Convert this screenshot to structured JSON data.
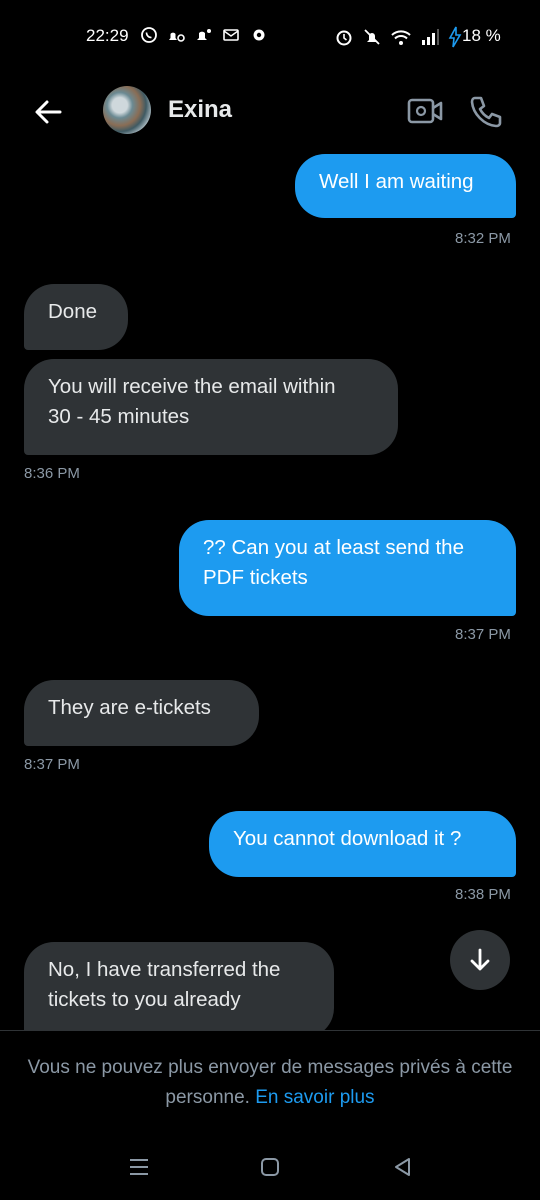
{
  "status_bar": {
    "time": "22:29",
    "battery": "18 %",
    "left_icons": [
      "whatsapp-icon",
      "notification-icon",
      "notification-icon",
      "mail-icon",
      "settings-icon"
    ],
    "right_icons": [
      "alarm-icon",
      "mute-icon",
      "wifi-icon",
      "signal-icon",
      "charging-icon"
    ]
  },
  "header": {
    "contact_name": "Exina",
    "icons": [
      "back-arrow-icon",
      "video-call-icon",
      "phone-icon"
    ]
  },
  "messages": [
    {
      "side": "sent",
      "text": "Well I am waiting"
    },
    {
      "side": "sent",
      "time": "8:32 PM"
    },
    {
      "side": "received",
      "text": "Done"
    },
    {
      "side": "received",
      "text": "You will receive the email within\n30 - 45 minutes"
    },
    {
      "side": "received",
      "time": "8:36 PM"
    },
    {
      "side": "sent",
      "text": "?? Can you at least send the\nPDF tickets"
    },
    {
      "side": "sent",
      "time": "8:37 PM"
    },
    {
      "side": "received",
      "text": "They are e-tickets"
    },
    {
      "side": "received",
      "time": "8:37 PM"
    },
    {
      "side": "sent",
      "text": "You cannot download it ?"
    },
    {
      "side": "sent",
      "time": "8:38 PM"
    },
    {
      "side": "received",
      "text": "No, I have transferred the\ntickets to you already"
    }
  ],
  "footer": {
    "notice": "Vous ne pouvez plus envoyer de messages privés à cette personne.",
    "link": "En savoir plus"
  },
  "colors": {
    "background": "#000000",
    "sent_bubble": "#1d9bf0",
    "received_bubble": "#2f3336",
    "timestamp": "#8b98a5",
    "link": "#1d9bf0"
  }
}
